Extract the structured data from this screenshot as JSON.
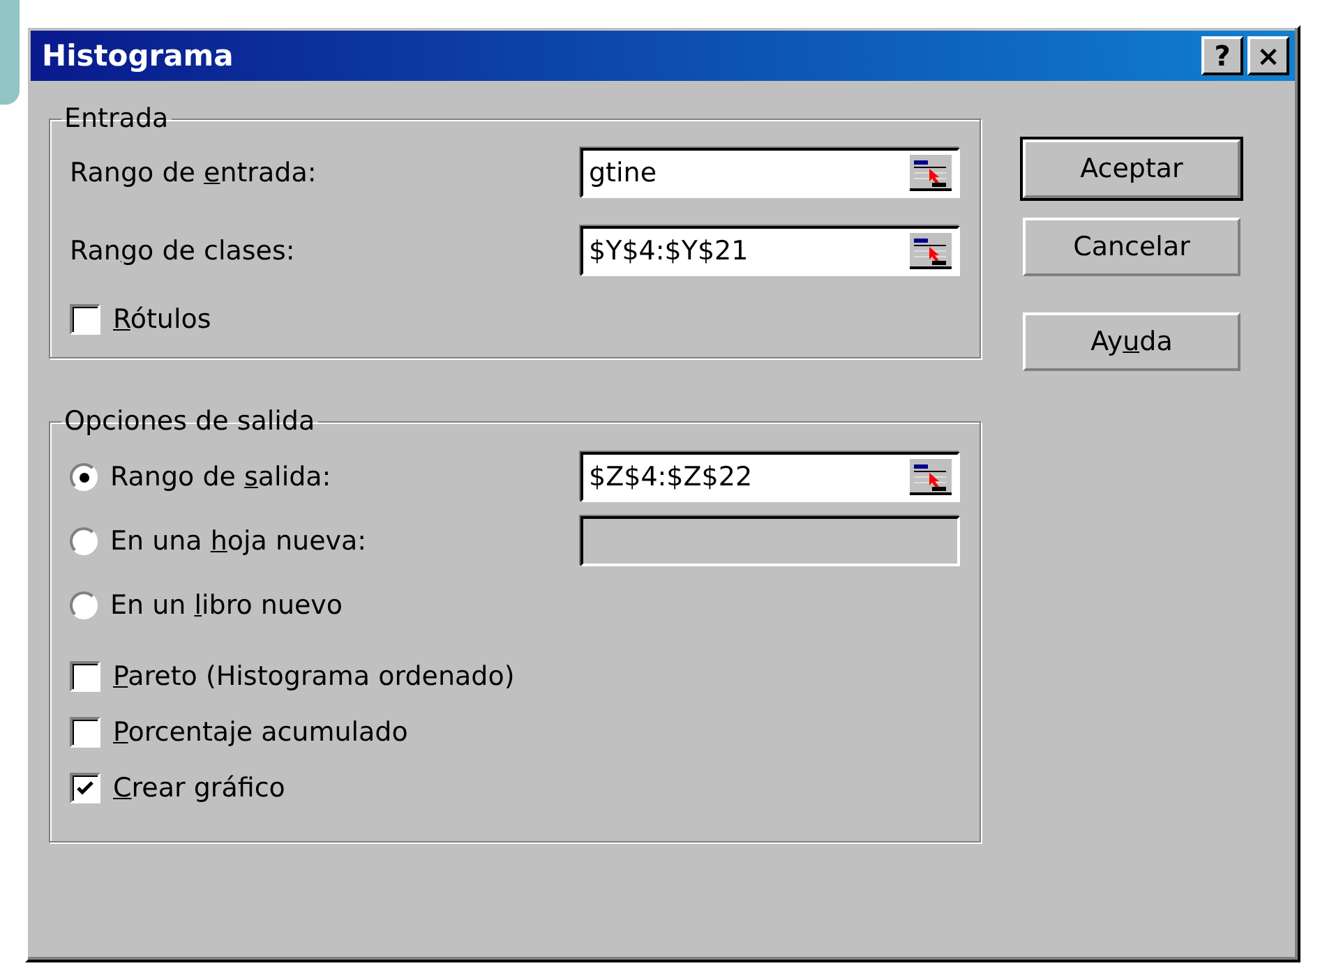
{
  "window": {
    "title": "Histograma",
    "title_buttons": [
      "?",
      "×"
    ]
  },
  "input_group": {
    "title": "Entrada",
    "fields": [
      {
        "label": {
          "pre": "Rango de ",
          "key": "e",
          "post": "ntrada:"
        },
        "value": "gtine",
        "disabled": false
      },
      {
        "label": {
          "pre": "Ran",
          "key": "g",
          "post": "o de clases:"
        },
        "value": "$Y$4:$Y$21",
        "disabled": false
      }
    ],
    "checkbox": {
      "label": {
        "key": "R",
        "post": "ótulos"
      },
      "checked": false
    }
  },
  "output_group": {
    "title": "Opciones de salida",
    "options": [
      {
        "kind": "radio",
        "label": {
          "pre": "Rango de ",
          "key": "s",
          "post": "alida:"
        },
        "selected": true,
        "field": {
          "value": "$Z$4:$Z$22",
          "disabled": false
        }
      },
      {
        "kind": "radio",
        "label": {
          "pre": "En una ",
          "key": "h",
          "post": "oja nueva:"
        },
        "selected": false,
        "field": {
          "disabled": true
        }
      },
      {
        "kind": "radio",
        "label": {
          "pre": "En un ",
          "key": "l",
          "post": "ibro nuevo"
        },
        "selected": false
      },
      {
        "kind": "checkbox",
        "label": {
          "key": "P",
          "post": "areto (Histograma ordenado)"
        },
        "checked": false
      },
      {
        "kind": "checkbox",
        "label": {
          "key": "P",
          "post": "orcentaje acumulado"
        },
        "checked": false
      },
      {
        "kind": "checkbox",
        "label": {
          "key": "C",
          "post": "rear gráfico"
        },
        "checked": true
      }
    ]
  },
  "buttons": [
    {
      "label": {
        "pre": "Aceptar"
      },
      "default": true
    },
    {
      "label": {
        "pre": "Cancelar"
      },
      "default": false
    },
    {
      "label": {
        "pre": "Ay",
        "key": "u",
        "post": "da"
      },
      "default": false
    }
  ]
}
